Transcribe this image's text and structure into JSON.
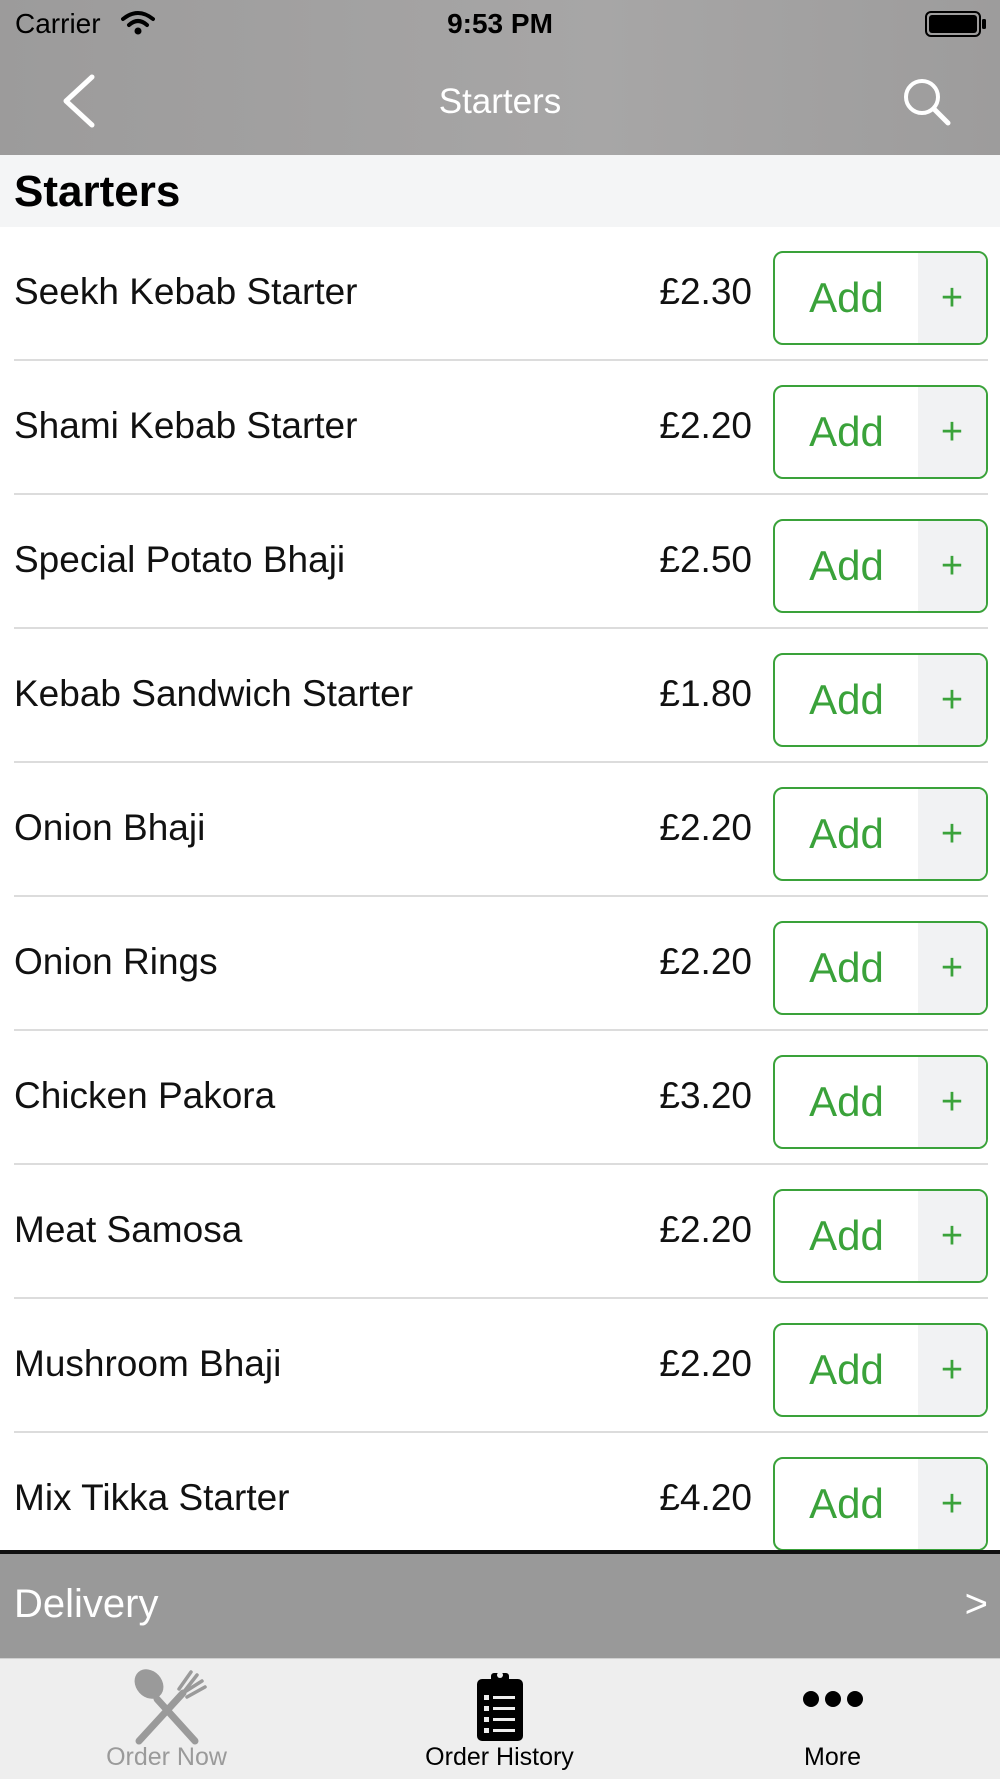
{
  "status_bar": {
    "carrier": "Carrier",
    "time": "9:53 PM",
    "icons": [
      "wifi-icon",
      "battery-icon"
    ]
  },
  "nav": {
    "title": "Starters",
    "back_icon": "chevron-left-icon",
    "search_icon": "search-icon"
  },
  "section": {
    "title": "Starters"
  },
  "items": [
    {
      "name": "Seekh Kebab Starter",
      "price": "£2.30",
      "add_label": "Add",
      "plus": "+"
    },
    {
      "name": "Shami Kebab Starter",
      "price": "£2.20",
      "add_label": "Add",
      "plus": "+"
    },
    {
      "name": "Special Potato Bhaji",
      "price": "£2.50",
      "add_label": "Add",
      "plus": "+"
    },
    {
      "name": "Kebab Sandwich Starter",
      "price": "£1.80",
      "add_label": "Add",
      "plus": "+"
    },
    {
      "name": "Onion Bhaji",
      "price": "£2.20",
      "add_label": "Add",
      "plus": "+"
    },
    {
      "name": "Onion Rings",
      "price": "£2.20",
      "add_label": "Add",
      "plus": "+"
    },
    {
      "name": "Chicken Pakora",
      "price": "£3.20",
      "add_label": "Add",
      "plus": "+"
    },
    {
      "name": "Meat Samosa",
      "price": "£2.20",
      "add_label": "Add",
      "plus": "+"
    },
    {
      "name": "Mushroom Bhaji",
      "price": "£2.20",
      "add_label": "Add",
      "plus": "+"
    },
    {
      "name": "Mix Tikka Starter",
      "price": "£4.20",
      "add_label": "Add",
      "plus": "+"
    }
  ],
  "delivery_bar": {
    "label": "Delivery",
    "arrow": ">"
  },
  "tabs": [
    {
      "label": "Order Now",
      "icon": "fork-knife-icon",
      "active": false
    },
    {
      "label": "Order History",
      "icon": "clipboard-list-icon",
      "active": true
    },
    {
      "label": "More",
      "icon": "more-dots-icon",
      "active": false
    }
  ],
  "colors": {
    "accent_green": "#3aa23a",
    "header_gray": "#a3a2a2",
    "delivery_gray": "#999999",
    "tab_bar_bg": "#eeeeee"
  }
}
